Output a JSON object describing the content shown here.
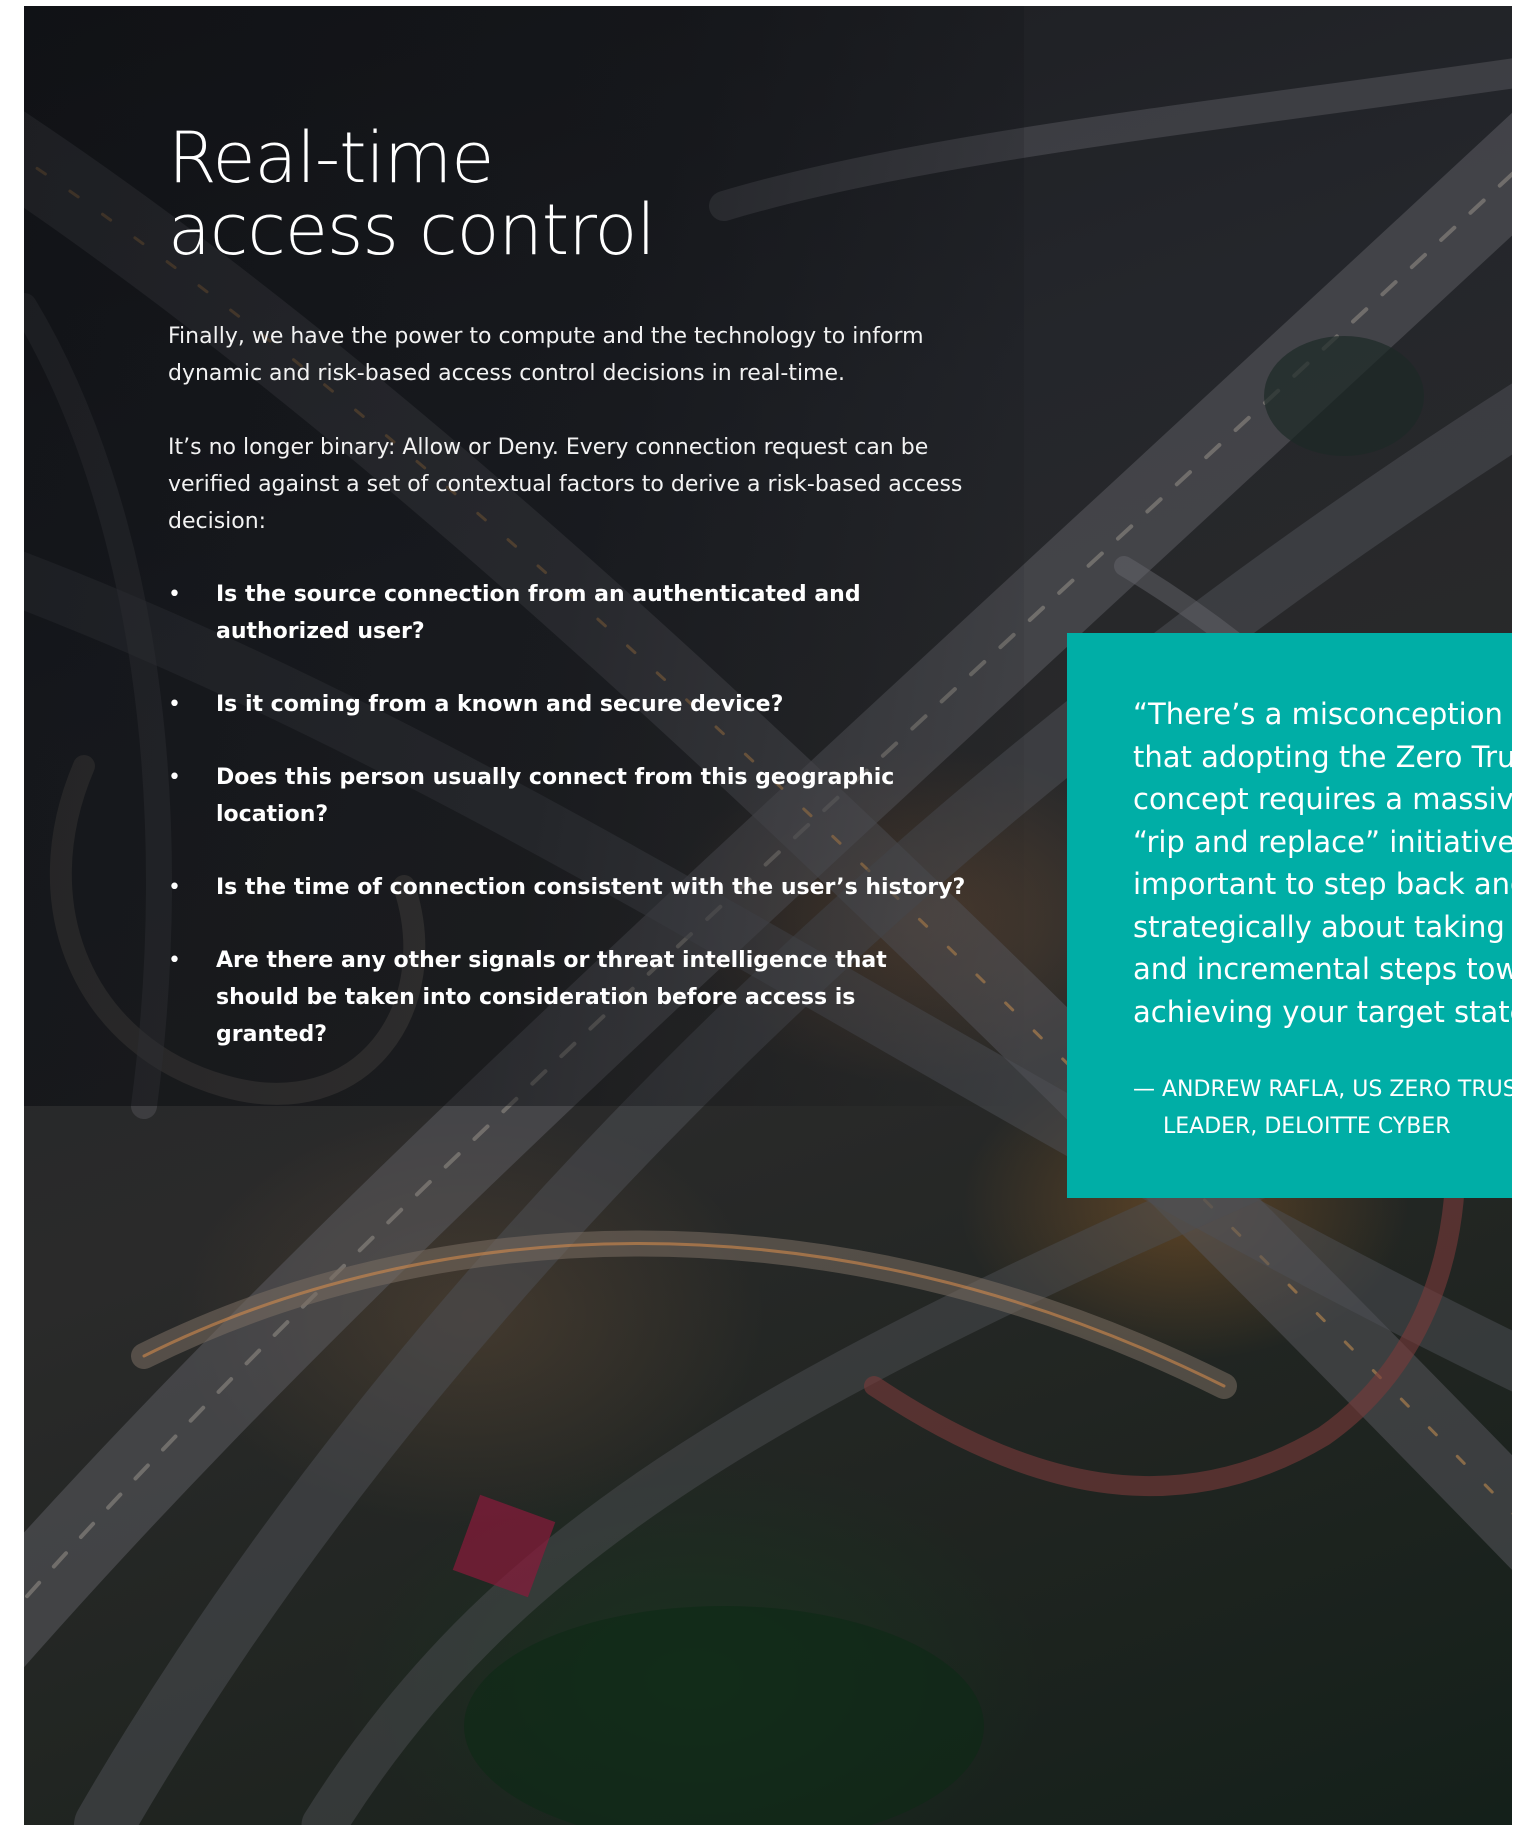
{
  "heading": {
    "line1": "Real-time",
    "line2": "access control"
  },
  "paragraphs": [
    "Finally, we have the power to compute and the technology to inform dynamic and risk-based access control decisions in real-time.",
    "It’s no longer binary: Allow or Deny. Every connection request can be verified against a set of contextual factors to derive a risk-based access decision:"
  ],
  "bullets": [
    "Is the source connection from an authenticated and authorized user?",
    "Is it coming from a known and secure device?",
    "Does this person usually connect from this geographic location?",
    "Is the time of connection consistent with the user’s history?",
    "Are there any other signals or threat intelligence that should be taken into consideration before access is granted?"
  ],
  "bullet_glyph": "•",
  "quote": {
    "lines": [
      "“There’s a misconception",
      "that adopting the Zero Trust",
      "concept requires a massive",
      "“rip and replace” initiative. It’s",
      "important to step back and think",
      "strategically about taking iterative",
      "and incremental steps toward",
      "achieving your target state.”"
    ],
    "attribution_line1": "— ANDREW RAFLA, US ZERO TRUST",
    "attribution_line2": "LEADER, DELOITTE CYBER"
  },
  "colors": {
    "quote_background": "#00aea6",
    "text": "#ffffff"
  },
  "background_image": "aerial-highway-interchange-at-dusk"
}
